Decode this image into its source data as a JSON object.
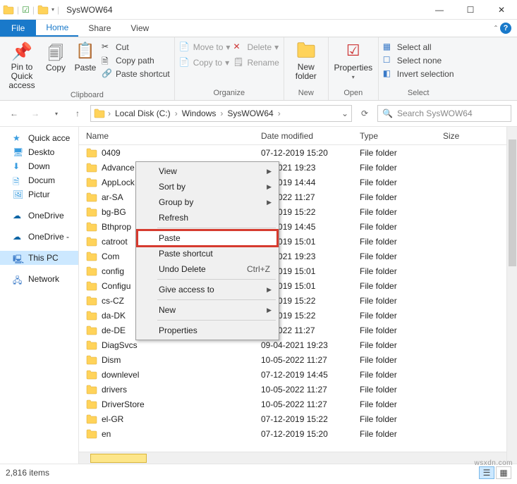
{
  "window": {
    "title": "SysWOW64"
  },
  "tabs": {
    "file": "File",
    "home": "Home",
    "share": "Share",
    "view": "View"
  },
  "ribbon": {
    "clipboard": {
      "label": "Clipboard",
      "pin": "Pin to Quick access",
      "copy": "Copy",
      "paste": "Paste",
      "cut": "Cut",
      "copypath": "Copy path",
      "pasteshortcut": "Paste shortcut"
    },
    "organize": {
      "label": "Organize",
      "moveto": "Move to",
      "copyto": "Copy to",
      "delete": "Delete",
      "rename": "Rename"
    },
    "new": {
      "label": "New",
      "newfolder": "New folder"
    },
    "open": {
      "label": "Open",
      "properties": "Properties"
    },
    "select": {
      "label": "Select",
      "all": "Select all",
      "none": "Select none",
      "invert": "Invert selection"
    }
  },
  "breadcrumbs": [
    "Local Disk (C:)",
    "Windows",
    "SysWOW64"
  ],
  "search": {
    "placeholder": "Search SysWOW64"
  },
  "navpane": {
    "quick": "Quick acce",
    "desktop": "Deskto",
    "downloads": "Down",
    "documents": "Docum",
    "pictures": "Pictur",
    "onedrive": "OneDrive",
    "onedrive2": "OneDrive -",
    "thispc": "This PC",
    "network": "Network"
  },
  "columns": {
    "name": "Name",
    "date": "Date modified",
    "type": "Type",
    "size": "Size"
  },
  "files": [
    {
      "name": "0409",
      "date": "07-12-2019 15:20",
      "type": "File folder"
    },
    {
      "name": "Advance",
      "date": "04-2021 19:23",
      "type": "File folder"
    },
    {
      "name": "AppLock",
      "date": "12-2019 14:44",
      "type": "File folder"
    },
    {
      "name": "ar-SA",
      "date": "05-2022 11:27",
      "type": "File folder"
    },
    {
      "name": "bg-BG",
      "date": "12-2019 15:22",
      "type": "File folder"
    },
    {
      "name": "Bthprop",
      "date": "12-2019 14:45",
      "type": "File folder"
    },
    {
      "name": "catroot",
      "date": "12-2019 15:01",
      "type": "File folder"
    },
    {
      "name": "Com",
      "date": "04-2021 19:23",
      "type": "File folder"
    },
    {
      "name": "config",
      "date": "12-2019 15:01",
      "type": "File folder"
    },
    {
      "name": "Configu",
      "date": "12-2019 15:01",
      "type": "File folder"
    },
    {
      "name": "cs-CZ",
      "date": "12-2019 15:22",
      "type": "File folder"
    },
    {
      "name": "da-DK",
      "date": "12-2019 15:22",
      "type": "File folder"
    },
    {
      "name": "de-DE",
      "date": "05-2022 11:27",
      "type": "File folder"
    },
    {
      "name": "DiagSvcs",
      "date": "09-04-2021 19:23",
      "type": "File folder"
    },
    {
      "name": "Dism",
      "date": "10-05-2022 11:27",
      "type": "File folder"
    },
    {
      "name": "downlevel",
      "date": "07-12-2019 14:45",
      "type": "File folder"
    },
    {
      "name": "drivers",
      "date": "10-05-2022 11:27",
      "type": "File folder"
    },
    {
      "name": "DriverStore",
      "date": "10-05-2022 11:27",
      "type": "File folder"
    },
    {
      "name": "el-GR",
      "date": "07-12-2019 15:22",
      "type": "File folder"
    },
    {
      "name": "en",
      "date": "07-12-2019 15:20",
      "type": "File folder"
    }
  ],
  "context": {
    "view": "View",
    "sortby": "Sort by",
    "groupby": "Group by",
    "refresh": "Refresh",
    "paste": "Paste",
    "pasteshortcut": "Paste shortcut",
    "undodelete": "Undo Delete",
    "undoshortcut": "Ctrl+Z",
    "giveaccess": "Give access to",
    "new": "New",
    "properties": "Properties"
  },
  "status": {
    "items": "2,816 items"
  },
  "watermark": "wsxdn.com"
}
